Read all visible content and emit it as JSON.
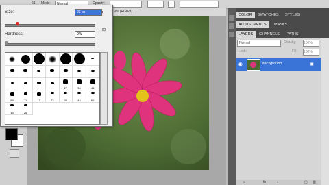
{
  "options_bar": {
    "tool_num": "61",
    "mode_label": "Mode:",
    "mode_value": "Normal",
    "opacity_label": "Opacity:",
    "doc_tab_text": "2.9% (RGB/8)"
  },
  "brush_picker": {
    "size_label": "Size:",
    "size_value": "23 px",
    "hardness_label": "Hardness:",
    "hardness_value": "0%",
    "size_fraction": 0.12,
    "hardness_fraction": 0.0,
    "brushes": [
      {
        "kind": "dot",
        "size": 9,
        "soft": true
      },
      {
        "kind": "dot",
        "size": 13,
        "soft": false
      },
      {
        "kind": "dot",
        "size": 16,
        "soft": false
      },
      {
        "kind": "dot",
        "size": 11,
        "soft": true
      },
      {
        "kind": "dot",
        "size": 16,
        "soft": false
      },
      {
        "kind": "dot",
        "size": 16,
        "soft": false
      },
      {
        "kind": "shape",
        "size": 4,
        "soft": false
      },
      {
        "kind": "shape",
        "size": 6,
        "soft": false
      },
      {
        "kind": "shape",
        "size": 6,
        "soft": false
      },
      {
        "kind": "shape",
        "size": 5,
        "soft": false
      },
      {
        "kind": "shape",
        "size": 6,
        "soft": false
      },
      {
        "kind": "shape",
        "size": 6,
        "soft": false
      },
      {
        "kind": "shape",
        "size": 5,
        "soft": false
      },
      {
        "kind": "shape",
        "size": 5,
        "soft": false
      },
      {
        "kind": "shape",
        "size": 4,
        "soft": false
      },
      {
        "kind": "shape",
        "size": 5,
        "soft": false
      },
      {
        "kind": "shape",
        "size": 6,
        "soft": false
      },
      {
        "kind": "shape",
        "size": 5,
        "soft": false
      },
      {
        "kind": "star",
        "size": 7,
        "soft": false,
        "num": "27"
      },
      {
        "kind": "star",
        "size": 7,
        "soft": false,
        "num": "39"
      },
      {
        "kind": "star",
        "size": 7,
        "soft": false,
        "num": "46"
      },
      {
        "kind": "star",
        "size": 6,
        "soft": false,
        "num": "59"
      },
      {
        "kind": "star",
        "size": 5,
        "soft": false,
        "num": "11"
      },
      {
        "kind": "star",
        "size": 6,
        "soft": false,
        "num": "17"
      },
      {
        "kind": "shape",
        "size": 5,
        "soft": false,
        "num": "23"
      },
      {
        "kind": "shape",
        "size": 5,
        "soft": false,
        "num": "36"
      },
      {
        "kind": "shape",
        "size": 5,
        "soft": false,
        "num": "44"
      },
      {
        "kind": "shape",
        "size": 5,
        "soft": false,
        "num": "60"
      },
      {
        "kind": "shape",
        "size": 5,
        "soft": false,
        "num": "14"
      },
      {
        "kind": "shape",
        "size": 5,
        "soft": false,
        "num": "26"
      }
    ]
  },
  "panels": {
    "top_tabs": [
      "COLOR",
      "SWATCHES",
      "STYLES"
    ],
    "mid_tabs": [
      "ADJUSTMENTS",
      "MASKS"
    ],
    "layer_tabs": [
      "LAYERS",
      "CHANNELS",
      "PATHS"
    ],
    "blend_mode": "Normal",
    "opacity_label": "Opacity:",
    "opacity_value": "100%",
    "lock_label": "Lock:",
    "fill_label": "Fill:",
    "fill_value": "100%",
    "layer_name": "Background"
  },
  "colors": {
    "accent_selected": "#3a74d7",
    "flower": "#e0337d",
    "foreground": "#000000",
    "background": "#ffffff"
  }
}
